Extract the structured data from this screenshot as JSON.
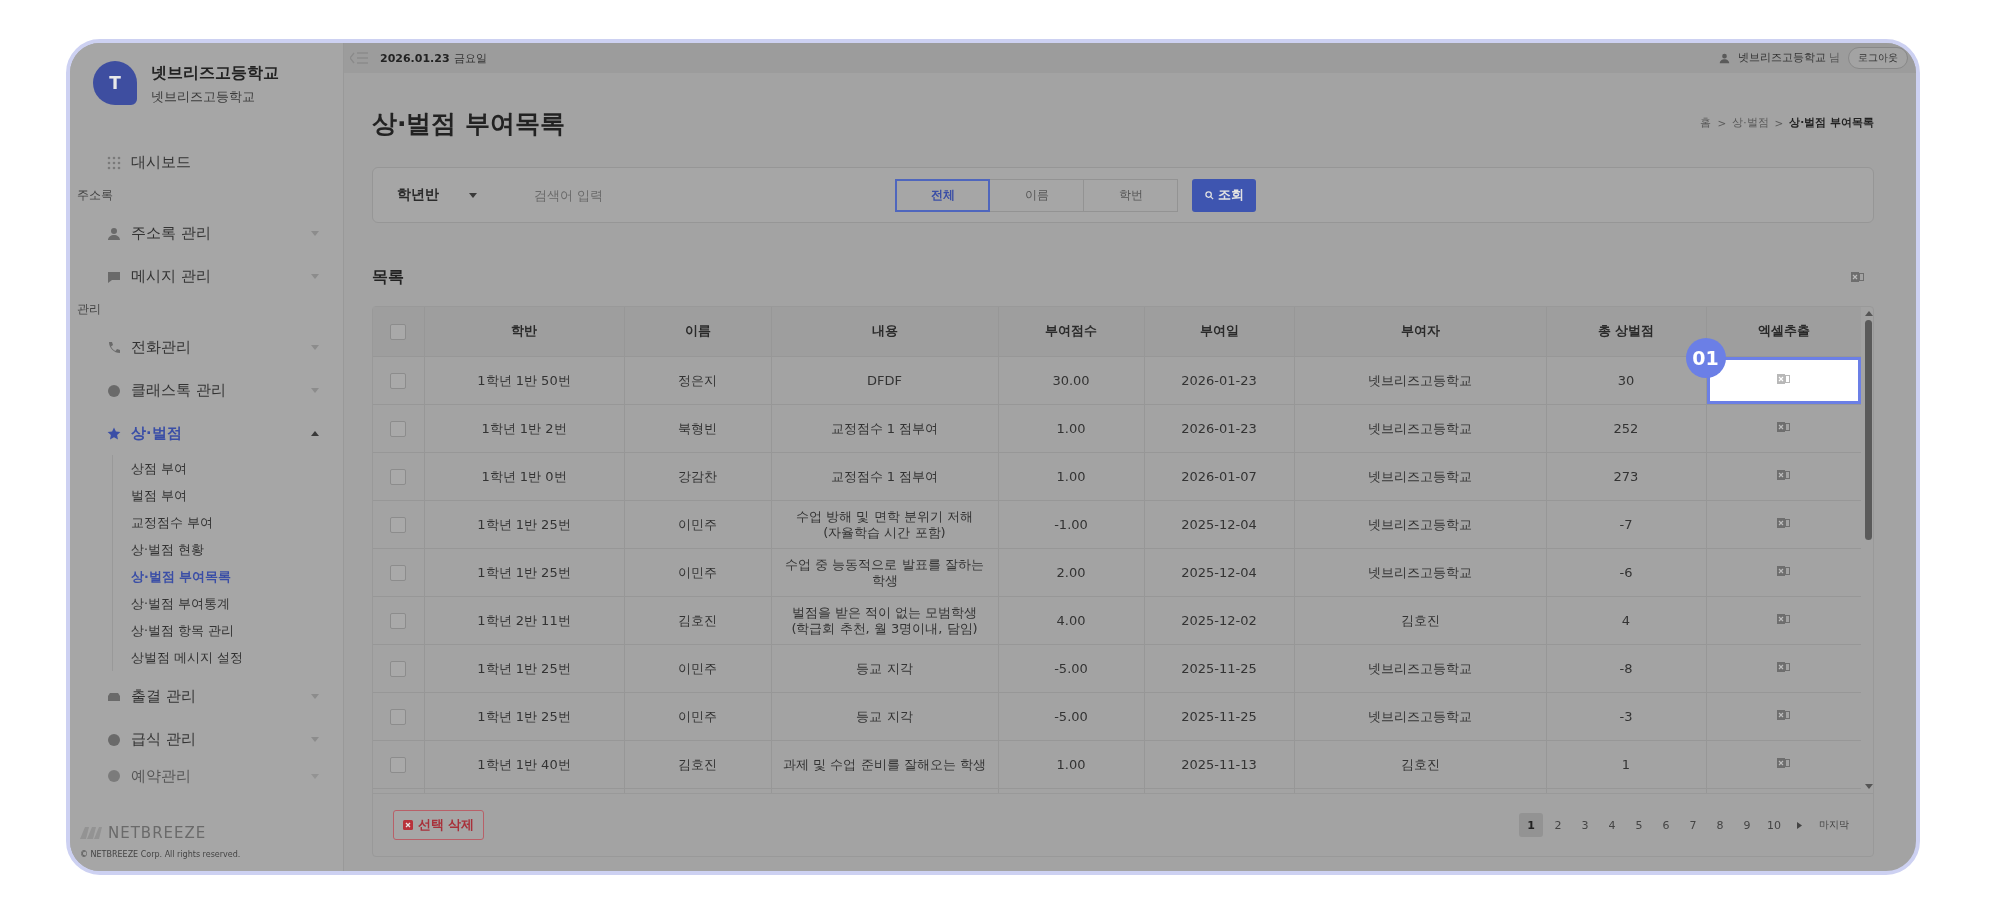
{
  "sidebar": {
    "profile": {
      "initial": "T",
      "name": "넷브리즈고등학교",
      "subtitle": "넷브리즈고등학교"
    },
    "nav": [
      {
        "kind": "link",
        "label": "대시보드"
      },
      {
        "kind": "section",
        "label": "주소록"
      },
      {
        "kind": "menu",
        "label": "주소록 관리",
        "selected": false,
        "expanded": false
      },
      {
        "kind": "menu",
        "label": "메시지 관리",
        "selected": false,
        "expanded": false
      },
      {
        "kind": "section",
        "label": "관리"
      },
      {
        "kind": "menu",
        "label": "전화관리",
        "selected": false,
        "expanded": false
      },
      {
        "kind": "menu",
        "label": "클래스톡 관리",
        "selected": false,
        "expanded": false
      },
      {
        "kind": "menu",
        "label": "상·벌점",
        "selected": true,
        "expanded": true,
        "children": [
          {
            "label": "상점 부여",
            "selected": false
          },
          {
            "label": "벌점 부여",
            "selected": false
          },
          {
            "label": "교정점수 부여",
            "selected": false
          },
          {
            "label": "상·벌점 현황",
            "selected": false
          },
          {
            "label": "상·벌점 부여목록",
            "selected": true
          },
          {
            "label": "상·벌점 부여통계",
            "selected": false
          },
          {
            "label": "상·벌점 항목 관리",
            "selected": false
          },
          {
            "label": "상벌점 메시지 설정",
            "selected": false
          }
        ]
      },
      {
        "kind": "menu",
        "label": "출결 관리",
        "selected": false,
        "expanded": false
      },
      {
        "kind": "menu",
        "label": "급식 관리",
        "selected": false,
        "expanded": false
      },
      {
        "kind": "menu",
        "label": "예약관리",
        "selected": false,
        "expanded": false
      }
    ],
    "brand": "NETBREEZE",
    "copyright": "© NETBREEZE Corp. All rights reserved."
  },
  "topbar": {
    "date": "2026.01.23",
    "weekday": "금요일",
    "user": "넷브리즈고등학교",
    "user_suffix": "님",
    "logout": "로그아웃"
  },
  "page_title": "상·벌점 부여목록",
  "breadcrumb": {
    "separator": ">",
    "items": [
      "홈",
      "상·벌점",
      "상·벌점 부여목록"
    ]
  },
  "filter": {
    "select": "학년반",
    "search": {
      "placeholder": "검색어 입력"
    },
    "segments": [
      {
        "label": "전체",
        "selected": true
      },
      {
        "label": "이름",
        "selected": false
      },
      {
        "label": "학번",
        "selected": false
      }
    ],
    "button": "조회"
  },
  "list_title": "목록",
  "table": {
    "header_checked": false,
    "columns": [
      "학반",
      "이름",
      "내용",
      "부여점수",
      "부여일",
      "부여자",
      "총 상벌점",
      "엑셀추출"
    ],
    "rows": [
      {
        "checked": false,
        "highlighted": true,
        "cells": [
          "1학년 1반 50번",
          "정은지",
          "DFDF",
          "30.00",
          "2026-01-23",
          "넷브리즈고등학교",
          "30"
        ]
      },
      {
        "checked": false,
        "highlighted": false,
        "cells": [
          "1학년 1반 2번",
          "북형빈",
          "교정점수 1 점부여",
          "1.00",
          "2026-01-23",
          "넷브리즈고등학교",
          "252"
        ]
      },
      {
        "checked": false,
        "highlighted": false,
        "cells": [
          "1학년 1반 0번",
          "강감찬",
          "교정점수 1 점부여",
          "1.00",
          "2026-01-07",
          "넷브리즈고등학교",
          "273"
        ]
      },
      {
        "checked": false,
        "highlighted": false,
        "cells": [
          "1학년 1반 25번",
          "이민주",
          "수업 방해 및 면학 분위기 저해\n(자율학습 시간 포함)",
          "-1.00",
          "2025-12-04",
          "넷브리즈고등학교",
          "-7"
        ]
      },
      {
        "checked": false,
        "highlighted": false,
        "cells": [
          "1학년 1반 25번",
          "이민주",
          "수업 중 능동적으로 발표를 잘하는\n학생",
          "2.00",
          "2025-12-04",
          "넷브리즈고등학교",
          "-6"
        ]
      },
      {
        "checked": false,
        "highlighted": false,
        "cells": [
          "1학년 2반 11번",
          "김호진",
          "벌점을 받은 적이 없는 모범학생\n(학급회 추천, 월 3명이내, 담임)",
          "4.00",
          "2025-12-02",
          "김호진",
          "4"
        ]
      },
      {
        "checked": false,
        "highlighted": false,
        "cells": [
          "1학년 1반 25번",
          "이민주",
          "등교 지각",
          "-5.00",
          "2025-11-25",
          "넷브리즈고등학교",
          "-8"
        ]
      },
      {
        "checked": false,
        "highlighted": false,
        "cells": [
          "1학년 1반 25번",
          "이민주",
          "등교 지각",
          "-5.00",
          "2025-11-25",
          "넷브리즈고등학교",
          "-3"
        ]
      },
      {
        "checked": false,
        "highlighted": false,
        "cells": [
          "1학년 1반 40번",
          "김호진",
          "과제 및 수업 준비를 잘해오는 학생",
          "1.00",
          "2025-11-13",
          "김호진",
          "1"
        ]
      }
    ]
  },
  "callout": {
    "label": "01"
  },
  "delete_button": "선택 삭제",
  "pagination": {
    "pages": [
      {
        "label": "1",
        "selected": true
      },
      {
        "label": "2",
        "selected": false
      },
      {
        "label": "3",
        "selected": false
      },
      {
        "label": "4",
        "selected": false
      },
      {
        "label": "5",
        "selected": false
      },
      {
        "label": "6",
        "selected": false
      },
      {
        "label": "7",
        "selected": false
      },
      {
        "label": "8",
        "selected": false
      },
      {
        "label": "9",
        "selected": false
      },
      {
        "label": "10",
        "selected": false
      }
    ],
    "last": "마지막"
  }
}
